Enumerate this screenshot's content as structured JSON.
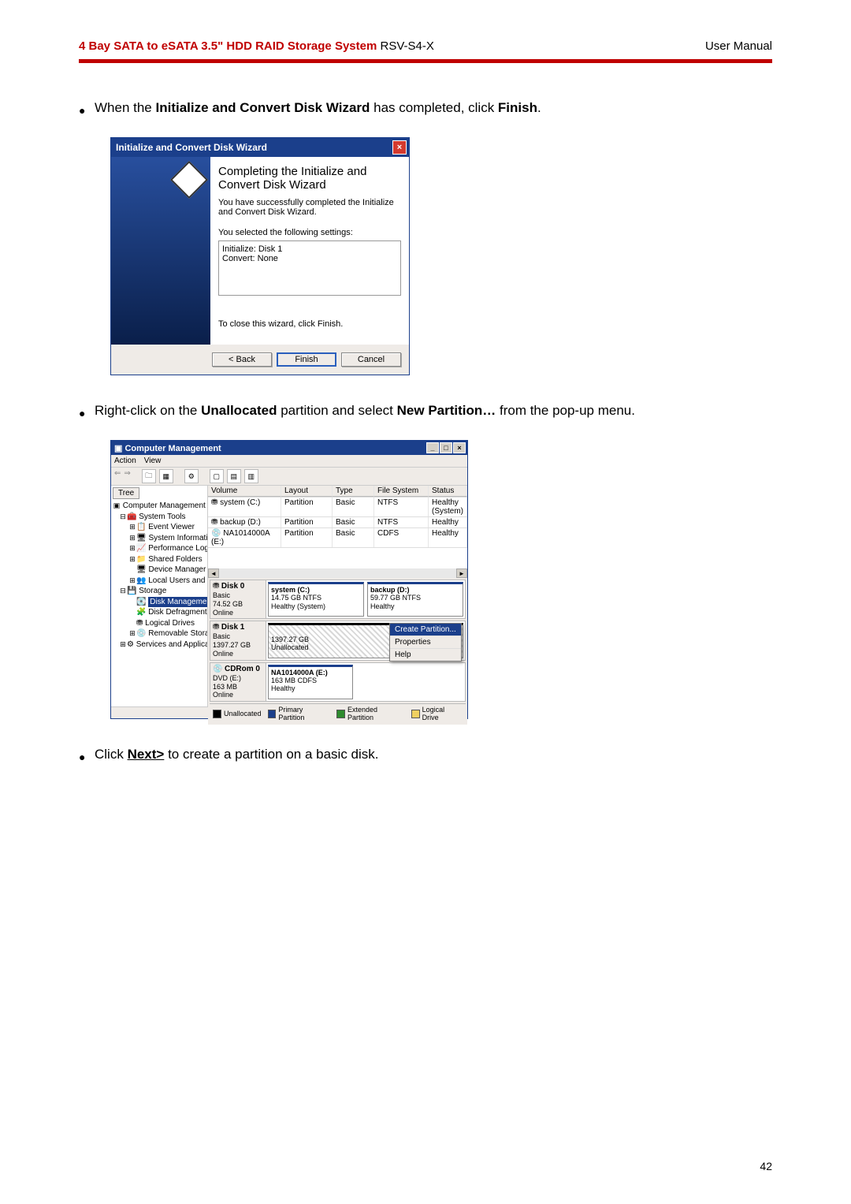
{
  "header": {
    "title_red": "4 Bay SATA to eSATA 3.5\" HDD RAID Storage System ",
    "title_black": "RSV-S4-X",
    "right": "User Manual"
  },
  "bullet1_pre": "When the ",
  "bullet1_bold": "Initialize and Convert Disk Wizard",
  "bullet1_mid": " has completed, click ",
  "bullet1_finish": "Finish",
  "bullet1_end": ".",
  "wizard": {
    "title": "Initialize and Convert Disk Wizard",
    "heading": "Completing the Initialize and Convert Disk Wizard",
    "p1": "You have successfully completed the Initialize and Convert Disk Wizard.",
    "p2": "You selected the following settings:",
    "sel1": "Initialize: Disk 1",
    "sel2": "Convert: None",
    "p3": "To close this wizard, click Finish.",
    "btn_back": "< Back",
    "btn_finish": "Finish",
    "btn_cancel": "Cancel"
  },
  "bullet2_pre": "Right-click on the ",
  "bullet2_unalloc": "Unallocated",
  "bullet2_mid": " partition and select ",
  "bullet2_newpart": "New Partition…",
  "bullet2_end": " from the pop-up menu.",
  "cm": {
    "title": "Computer Management",
    "menu": {
      "action": "Action",
      "view": "View"
    },
    "tab": "Tree",
    "tree": {
      "root": "Computer Management (Local)",
      "systools": "System Tools",
      "ev": "Event Viewer",
      "si": "System Information",
      "pla": "Performance Logs and Alerts",
      "sf": "Shared Folders",
      "dm": "Device Manager",
      "lug": "Local Users and Groups",
      "storage": "Storage",
      "diskmgmt": "Disk Management",
      "defrag": "Disk Defragmenter",
      "logdrv": "Logical Drives",
      "remstor": "Removable Storage",
      "sa": "Services and Applications"
    },
    "columns": {
      "vol": "Volume",
      "lay": "Layout",
      "typ": "Type",
      "fs": "File System",
      "sta": "Status"
    },
    "rows": [
      {
        "vol": "system (C:)",
        "lay": "Partition",
        "typ": "Basic",
        "fs": "NTFS",
        "sta": "Healthy (System)"
      },
      {
        "vol": "backup (D:)",
        "lay": "Partition",
        "typ": "Basic",
        "fs": "NTFS",
        "sta": "Healthy"
      },
      {
        "vol": "NA1014000A (E:)",
        "lay": "Partition",
        "typ": "Basic",
        "fs": "CDFS",
        "sta": "Healthy"
      }
    ],
    "disk0": {
      "name": "Disk 0",
      "kind": "Basic",
      "size": "74.52 GB",
      "state": "Online",
      "p1_name": "system  (C:)",
      "p1_l2": "14.75 GB NTFS",
      "p1_l3": "Healthy (System)",
      "p2_name": "backup  (D:)",
      "p2_l2": "59.77 GB NTFS",
      "p2_l3": "Healthy"
    },
    "disk1": {
      "name": "Disk 1",
      "kind": "Basic",
      "size": "1397.27 GB",
      "state": "Online",
      "u_l1": "1397.27 GB",
      "u_l2": "Unallocated"
    },
    "cdrom": {
      "name": "CDRom 0",
      "kind": "DVD (E:)",
      "size": "163 MB",
      "state": "Online",
      "p_l1": "NA1014000A  (E:)",
      "p_l2": "163 MB CDFS",
      "p_l3": "Healthy"
    },
    "ctx": {
      "create": "Create Partition...",
      "props": "Properties",
      "help": "Help"
    },
    "legend": {
      "un": "Unallocated",
      "pp": "Primary Partition",
      "ep": "Extended Partition",
      "ld": "Logical Drive"
    }
  },
  "bullet3_pre": "Click ",
  "bullet3_next": "Next>",
  "bullet3_end": " to create a partition on a basic disk.",
  "page_num": "42"
}
